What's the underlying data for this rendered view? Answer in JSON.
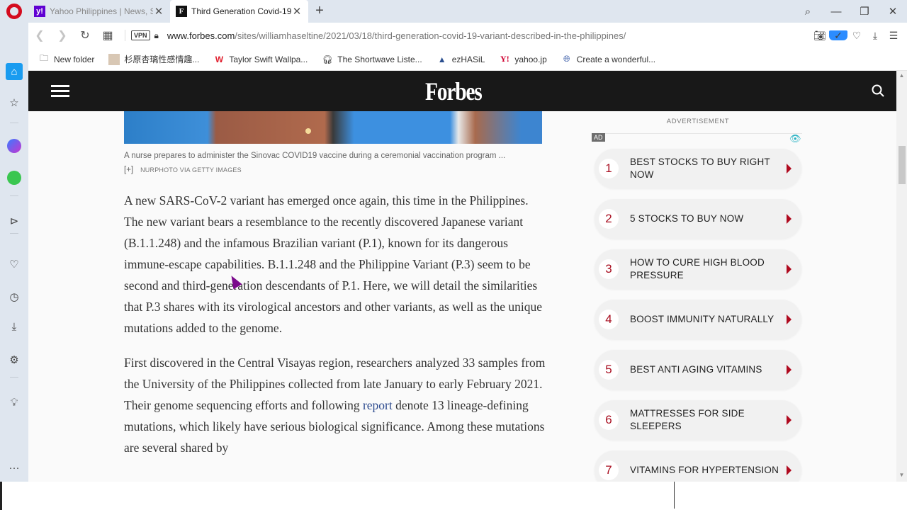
{
  "browser": {
    "tabs": [
      {
        "title": "Yahoo Philippines | News, S",
        "favicon": "yahoo-icon",
        "active": false
      },
      {
        "title": "Third Generation Covid-19",
        "favicon": "forbes-icon",
        "active": true
      }
    ],
    "new_tab_label": "+",
    "window_controls": {
      "search": "⌕",
      "minimize": "—",
      "restore": "❐",
      "close": "✕"
    },
    "address": {
      "url_domain": "www.forbes.com",
      "url_path": "/sites/williamhaseltine/2021/03/18/third-generation-covid-19-variant-described-in-the-philippines/",
      "vpn_label": "VPN"
    },
    "bookmarks": [
      {
        "label": "New folder",
        "icon": "folder-icon"
      },
      {
        "label": "杉原杏璃性感情趣...",
        "icon": "photo-thumb-icon"
      },
      {
        "label": "Taylor Swift Wallpa...",
        "icon": "w-logo-icon"
      },
      {
        "label": "The Shortwave Liste...",
        "icon": "headphones-icon"
      },
      {
        "label": "ezHASiL",
        "icon": "mountain-icon"
      },
      {
        "label": "yahoo.jp",
        "icon": "yahoo-jp-icon"
      },
      {
        "label": "Create a wonderful...",
        "icon": "globe-icon"
      }
    ]
  },
  "site": {
    "logo": "Forbes",
    "image_caption": "A nurse prepares to administer the Sinovac COVID19 vaccine during a ceremonial vaccination program ... [+]",
    "image_credit": "NURPHOTO VIA GETTY IMAGES",
    "paragraphs": [
      {
        "text": "A new SARS-CoV-2 variant has emerged once again, this time in the Philippines. The new variant bears a resemblance to the recently discovered Japanese variant (B.1.1.248) and the infamous Brazilian variant (P.1), known for its dangerous immune-escape capabilities. B.1.1.248 and the Philippine Variant (P.3) seem to be second and third-generation descendants of P.1. Here, we will detail the similarities that P.3 shares with its virological ancestors and other variants, as well as the unique mutations added to the genome."
      },
      {
        "before_link": "First discovered in the Central Visayas region, researchers analyzed 33 samples from the University of the Philippines collected from late January to early February 2021. Their genome sequencing efforts and following ",
        "link": "report",
        "after_link": " denote 13 lineage-defining mutations, which likely have serious biological significance. Among these mutations are several shared by"
      }
    ],
    "ad": {
      "label": "ADVERTISEMENT",
      "badge": "AD",
      "items": [
        {
          "num": "1",
          "text": "BEST STOCKS TO BUY RIGHT NOW"
        },
        {
          "num": "2",
          "text": "5 STOCKS TO BUY NOW"
        },
        {
          "num": "3",
          "text": "HOW TO CURE HIGH BLOOD PRESSURE"
        },
        {
          "num": "4",
          "text": "BOOST IMMUNITY NATURALLY"
        },
        {
          "num": "5",
          "text": "BEST ANTI AGING VITAMINS"
        },
        {
          "num": "6",
          "text": "MATTRESSES FOR SIDE SLEEPERS"
        },
        {
          "num": "7",
          "text": "VITAMINS FOR HYPERTENSION"
        }
      ]
    }
  },
  "colors": {
    "accent_red": "#b00a1f",
    "header_bg": "#181818",
    "link": "#2e4c8f",
    "opera_red": "#d40b1e"
  }
}
